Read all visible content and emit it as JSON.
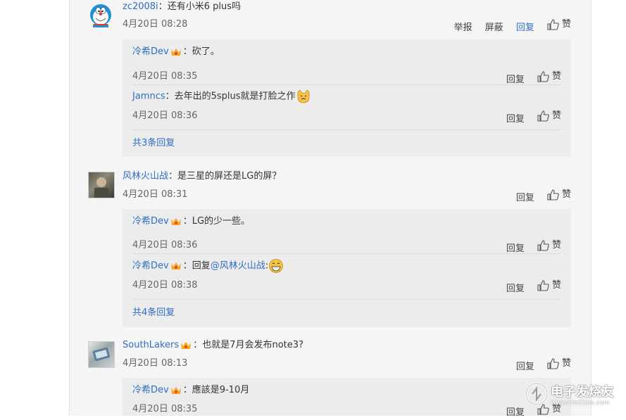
{
  "comments": [
    {
      "user": "zc2008i",
      "colon": "：",
      "text": "还有小米6 plus吗",
      "time": "4月20日 08:28",
      "actions": {
        "report": "举报",
        "block": "屏蔽",
        "reply": "回复",
        "like": "赞"
      },
      "avatar": "doraemon-avatar",
      "replies": [
        {
          "user": "冷希Dev",
          "colon": "：",
          "text": "砍了。",
          "time": "4月20日 08:35",
          "reply": "回复",
          "like": "赞"
        },
        {
          "user": "Jamncs",
          "colon": "：",
          "text": "去年出的5splus就是打脸之作",
          "time": "4月20日 08:36",
          "reply": "回复",
          "like": "赞",
          "emoji": "cat-face-emoji"
        }
      ],
      "more": "共3条回复"
    },
    {
      "user": "风林火山战",
      "colon": "：",
      "text": "是三星的屏还是LG的屏？",
      "time": "4月20日 08:31",
      "actions": {
        "reply": "回复",
        "like": "赞"
      },
      "avatar": "photo-avatar",
      "replies": [
        {
          "user": "冷希Dev",
          "colon": "：",
          "text": "LG的少一些。",
          "time": "4月20日 08:36",
          "reply": "回复",
          "like": "赞"
        },
        {
          "user": "冷希Dev",
          "colon": "：",
          "text_prefix": "回复",
          "mention": "@风林火山战",
          "text_suffix": ":",
          "time": "4月20日 08:38",
          "reply": "回复",
          "like": "赞",
          "emoji": "grin-emoji"
        }
      ],
      "more": "共4条回复"
    },
    {
      "user": "SouthLakers",
      "colon": "：",
      "text": "也就是7月会发布note3?",
      "time": "4月20日 08:13",
      "actions": {
        "reply": "回复",
        "like": "赞"
      },
      "avatar": "phone-photo-avatar",
      "replies": [
        {
          "user": "冷希Dev",
          "colon": "：",
          "text": "應該是9-10月",
          "time": "4月20日 08:35",
          "reply": "回复",
          "like": "赞"
        }
      ]
    }
  ],
  "watermark": {
    "title": "电子发烧友",
    "url": "www.elecfans.com"
  },
  "colors": {
    "link": "#2f6ec2",
    "panel": "#f5f5f5",
    "reply_bg": "#ececec"
  }
}
